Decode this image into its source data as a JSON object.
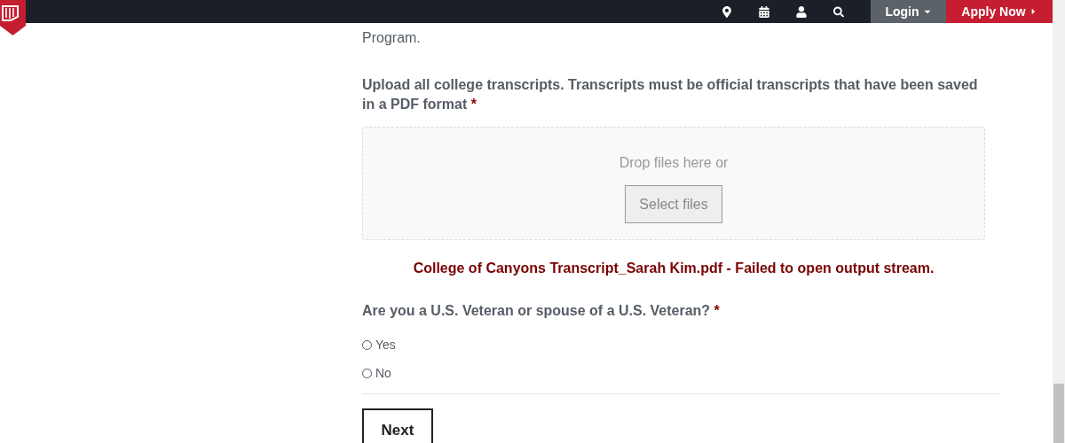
{
  "nav": {
    "login": "Login",
    "apply": "Apply Now"
  },
  "intro_tail": "Program.",
  "upload": {
    "label": "Upload all college transcripts. Transcripts must be official transcripts that have been saved in a PDF format",
    "required_mark": "*",
    "drop_text": "Drop files here or",
    "button": "Select files",
    "error": "College of Canyons Transcript_Sarah Kim.pdf - Failed to open output stream."
  },
  "veteran": {
    "label": "Are you a U.S. Veteran or spouse of a U.S. Veteran?",
    "required_mark": "*",
    "options": [
      {
        "label": "Yes",
        "selected": false
      },
      {
        "label": "No",
        "selected": false
      }
    ]
  },
  "next_button": "Next"
}
